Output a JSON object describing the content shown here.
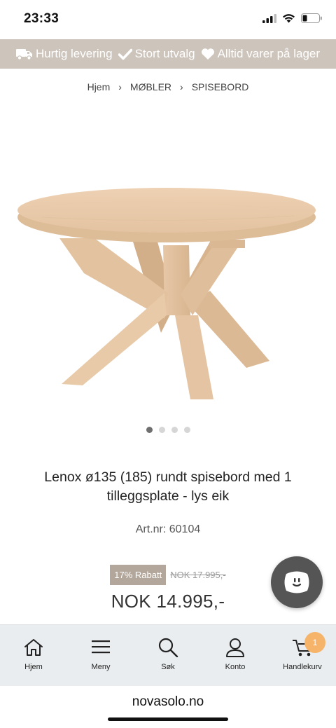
{
  "status": {
    "time": "23:33"
  },
  "usp_banner": {
    "items": [
      {
        "icon": "truck-icon",
        "label": "Hurtig levering"
      },
      {
        "icon": "checkmark-icon",
        "label": "Stort utvalg"
      },
      {
        "icon": "heart-icon",
        "label": "Alltid varer på lager"
      }
    ]
  },
  "breadcrumb": {
    "items": [
      "Hjem",
      "MØBLER",
      "SPISEBORD"
    ]
  },
  "product": {
    "image_alt": "Lenox rundt spisebord lys eik",
    "carousel": {
      "count": 4,
      "active_index": 0
    },
    "title": "Lenox ø135 (185) rundt spisebord med 1 tilleggsplate - lys eik",
    "art_nr": "Art.nr: 60104",
    "discount_label": "17% Rabatt",
    "old_price": "NOK 17.995,-",
    "price": "NOK 14.995,-"
  },
  "bottom_nav": {
    "items": [
      {
        "label": "Hjem",
        "icon": "home-icon"
      },
      {
        "label": "Meny",
        "icon": "menu-icon"
      },
      {
        "label": "Søk",
        "icon": "search-icon"
      },
      {
        "label": "Konto",
        "icon": "user-icon"
      },
      {
        "label": "Handlekurv",
        "icon": "cart-icon",
        "badge": "1"
      }
    ]
  },
  "browser": {
    "url": "novasolo.no"
  },
  "colors": {
    "banner_bg": "#cdc4bb",
    "discount_badge_bg": "#b3a79b",
    "cart_badge_bg": "#f6b46b",
    "nav_bg": "#e9edef"
  }
}
